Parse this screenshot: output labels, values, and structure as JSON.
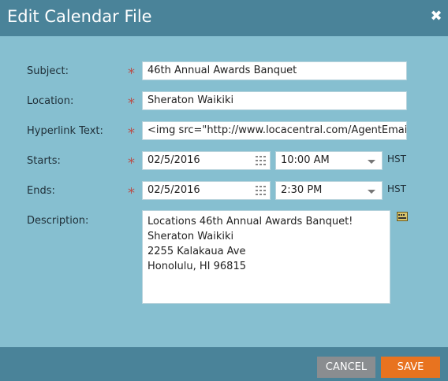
{
  "dialog": {
    "title": "Edit Calendar File",
    "close_symbol": "✖"
  },
  "form": {
    "subject": {
      "label": "Subject:",
      "value": "46th Annual Awards Banquet"
    },
    "location": {
      "label": "Location:",
      "value": "Sheraton Waikiki"
    },
    "hyperlink": {
      "label": "Hyperlink Text:",
      "value": "<img src=\"http://www.locacentral.com/AgentEmail"
    },
    "starts": {
      "label": "Starts:",
      "date": "02/5/2016",
      "time": "10:00 AM",
      "tz": "HST"
    },
    "ends": {
      "label": "Ends:",
      "date": "02/5/2016",
      "time": "2:30 PM",
      "tz": "HST"
    },
    "description": {
      "label": "Description:",
      "value": "Locations 46th Annual Awards Banquet!\nSheraton Waikiki\n2255 Kalakaua Ave\nHonolulu, HI 96815"
    },
    "required_marker": "*"
  },
  "footer": {
    "cancel_label": "CANCEL",
    "save_label": "SAVE"
  },
  "colors": {
    "titlebar": "#4a8399",
    "body": "#86bfd0",
    "save": "#e8731f",
    "cancel": "#8a8d90",
    "required": "#b94f4a"
  },
  "icons": {
    "close": "close-icon",
    "calendar": "calendar-icon",
    "dropdown": "chevron-down-icon",
    "notes": "notes-icon"
  }
}
